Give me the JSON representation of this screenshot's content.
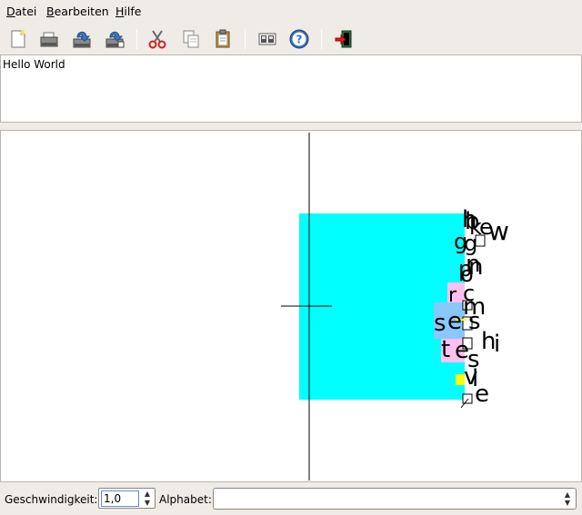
{
  "menubar": {
    "items": [
      {
        "label": "Datei",
        "accel": "D"
      },
      {
        "label": "Bearbeiten",
        "accel": "B"
      },
      {
        "label": "Hilfe",
        "accel": "H"
      }
    ]
  },
  "toolbar": {
    "buttons": [
      {
        "name": "new-document-button",
        "icon": "new-document-icon"
      },
      {
        "name": "open-button",
        "icon": "open-folder-icon"
      },
      {
        "name": "save-button",
        "icon": "save-icon"
      },
      {
        "name": "save-as-button",
        "icon": "save-as-icon"
      },
      {
        "name": "cut-button",
        "icon": "scissors-icon"
      },
      {
        "name": "copy-button",
        "icon": "copy-icon"
      },
      {
        "name": "paste-button",
        "icon": "clipboard-icon"
      },
      {
        "name": "preferences-button",
        "icon": "preferences-icon"
      },
      {
        "name": "help-button",
        "icon": "help-icon"
      },
      {
        "name": "quit-button",
        "icon": "exit-door-icon"
      }
    ]
  },
  "editor": {
    "text": "Hello World"
  },
  "canvas": {
    "letters": [
      {
        "char": "h"
      },
      {
        "char": "b"
      },
      {
        "char": "k"
      },
      {
        "char": "e"
      },
      {
        "char": "w"
      },
      {
        "char": "g"
      },
      {
        "char": "g"
      },
      {
        "char": "n"
      },
      {
        "char": "p"
      },
      {
        "char": "n"
      },
      {
        "char": "o"
      },
      {
        "char": "r"
      },
      {
        "char": "c"
      },
      {
        "char": "m"
      },
      {
        "char": "s"
      },
      {
        "char": "e"
      },
      {
        "char": "s"
      },
      {
        "char": "h"
      },
      {
        "char": "i"
      },
      {
        "char": "t"
      },
      {
        "char": "e"
      },
      {
        "char": "s"
      },
      {
        "char": "v"
      },
      {
        "char": "l"
      },
      {
        "char": "e"
      }
    ],
    "colors": {
      "main_box": "#00ffff",
      "pink": "#ffc0f0",
      "blue": "#88c8ff",
      "yellow": "#ffff00",
      "crosshair": "#000000"
    }
  },
  "statusbar": {
    "speed_label": "Geschwindigkeit:",
    "speed_value": "1,0",
    "alphabet_label": "Alphabet:",
    "alphabet_value": ""
  }
}
